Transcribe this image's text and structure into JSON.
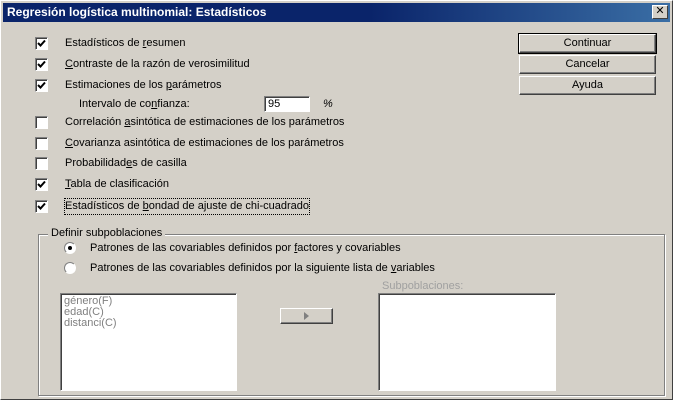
{
  "window": {
    "title": "Regresión logística multinomial: Estadísticos",
    "close_glyph": "✕"
  },
  "checkboxes": [
    {
      "pre": "Estadísticos de ",
      "u": "r",
      "post": "esumen",
      "checked": true
    },
    {
      "pre": "",
      "u": "C",
      "post": "ontraste de la razón de verosimilitud",
      "checked": true
    },
    {
      "pre": "Estimaciones de los ",
      "u": "p",
      "post": "arámetros",
      "checked": true
    },
    {
      "pre": "Correlación ",
      "u": "a",
      "post": "sintótica de estimaciones de los parámetros",
      "checked": false
    },
    {
      "pre": "",
      "u": "C",
      "post": "ovarianza asintótica de estimaciones de los parámetros",
      "checked": false
    },
    {
      "pre": "Probabilidad",
      "u": "e",
      "post": "s de casilla",
      "checked": false
    },
    {
      "pre": "",
      "u": "T",
      "post": "abla de clasificación",
      "checked": true
    },
    {
      "pre": "Estadísticos de ",
      "u": "b",
      "post": "ondad de ajuste de chi-cuadrado",
      "checked": true
    }
  ],
  "confidence": {
    "pre": "Intervalo de co",
    "u": "n",
    "post": "fianza:",
    "value": "95",
    "unit": "%"
  },
  "buttons": {
    "continue": "Continuar",
    "cancel": "Cancelar",
    "help": "Ayuda"
  },
  "subpopulations": {
    "group_title": "Definir subpoblaciones",
    "options": [
      {
        "pre": "Patrones de las covariables definidos por ",
        "u": "f",
        "post": "actores y covariables",
        "selected": true
      },
      {
        "pre": "Patrones de las covariables definidos por la siguiente lista de ",
        "u": "v",
        "post": "ariables",
        "selected": false
      }
    ],
    "variables": [
      "género(F)",
      "edad(C)",
      "distanci(C)"
    ],
    "list_label": "Subpoblaciones:"
  }
}
